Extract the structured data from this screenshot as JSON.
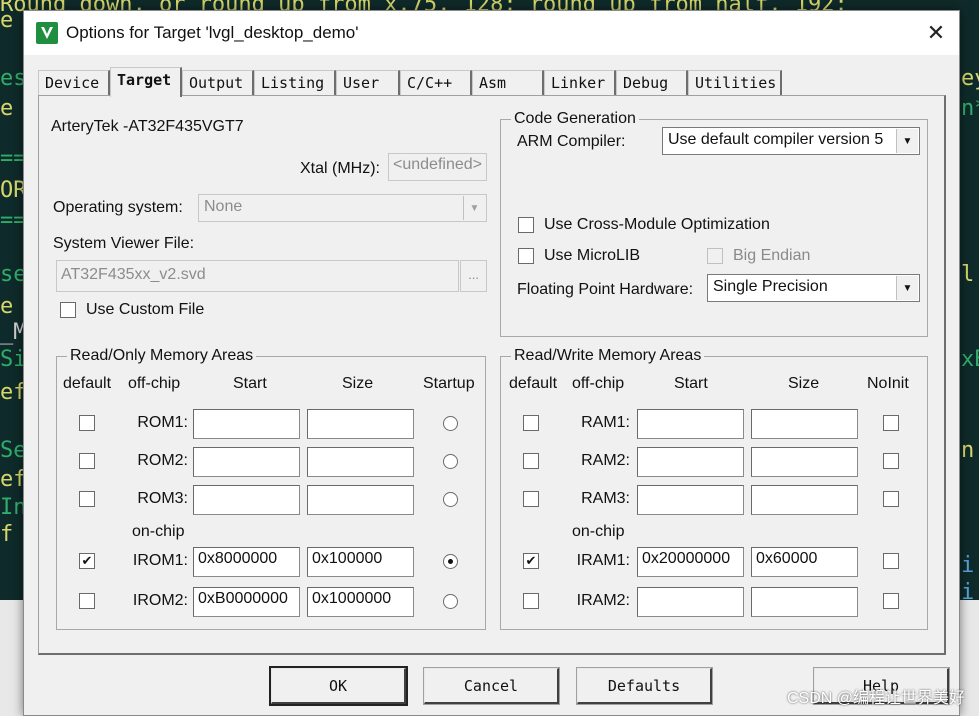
{
  "window": {
    "title": "Options for Target 'lvgl_desktop_demo'",
    "app_icon": "keil-uvision-icon",
    "close_label": "✕"
  },
  "tabs": [
    "Device",
    "Target",
    "Output",
    "Listing",
    "User",
    "C/C++",
    "Asm",
    "Linker",
    "Debug",
    "Utilities"
  ],
  "active_tab": "Target",
  "target": {
    "device_name": "ArteryTek -AT32F435VGT7",
    "xtal_label": "Xtal (MHz):",
    "xtal_value": "<undefined>",
    "os_label": "Operating system:",
    "os_value": "None",
    "svd_label": "System Viewer File:",
    "svd_value": "AT32F435xx_v2.svd",
    "browse_label": "...",
    "custom_file_label": "Use Custom File",
    "custom_file_checked": false
  },
  "code_generation": {
    "title": "Code Generation",
    "compiler_label": "ARM Compiler:",
    "compiler_value": "Use default compiler version 5",
    "cross_module_label": "Use Cross-Module Optimization",
    "cross_module_checked": false,
    "microlib_label": "Use MicroLIB",
    "microlib_checked": false,
    "big_endian_label": "Big Endian",
    "big_endian_checked": false,
    "fpu_label": "Floating Point Hardware:",
    "fpu_value": "Single Precision"
  },
  "ro_memory": {
    "title": "Read/Only Memory Areas",
    "col_default": "default",
    "col_offchip": "off-chip",
    "col_start": "Start",
    "col_size": "Size",
    "col_startup": "Startup",
    "onchip_label": "on-chip",
    "rows": [
      {
        "name": "ROM1:",
        "start": "",
        "size": "",
        "default": false,
        "startup": false
      },
      {
        "name": "ROM2:",
        "start": "",
        "size": "",
        "default": false,
        "startup": false
      },
      {
        "name": "ROM3:",
        "start": "",
        "size": "",
        "default": false,
        "startup": false
      },
      {
        "name": "IROM1:",
        "start": "0x8000000",
        "size": "0x100000",
        "default": true,
        "startup": true
      },
      {
        "name": "IROM2:",
        "start": "0xB0000000",
        "size": "0x1000000",
        "default": false,
        "startup": false
      }
    ]
  },
  "rw_memory": {
    "title": "Read/Write Memory Areas",
    "col_default": "default",
    "col_offchip": "off-chip",
    "col_start": "Start",
    "col_size": "Size",
    "col_noinit": "NoInit",
    "onchip_label": "on-chip",
    "rows": [
      {
        "name": "RAM1:",
        "start": "",
        "size": "",
        "default": false,
        "noinit": false
      },
      {
        "name": "RAM2:",
        "start": "",
        "size": "",
        "default": false,
        "noinit": false
      },
      {
        "name": "RAM3:",
        "start": "",
        "size": "",
        "default": false,
        "noinit": false
      },
      {
        "name": "IRAM1:",
        "start": "0x20000000",
        "size": "0x60000",
        "default": true,
        "noinit": false
      },
      {
        "name": "IRAM2:",
        "start": "",
        "size": "",
        "default": false,
        "noinit": false
      }
    ]
  },
  "buttons": {
    "ok": "OK",
    "cancel": "Cancel",
    "defaults": "Defaults",
    "help": "Help"
  },
  "background": {
    "top_code": "Round down, or round up from x.75, 128: round up from half, 192:",
    "left_chars": [
      "e",
      "es",
      "e",
      "==",
      "OR",
      "==",
      "se",
      "e",
      "_M",
      "Si",
      "ef",
      "Se",
      "ef",
      "In",
      "f"
    ],
    "right_chars": [
      "ey",
      "n*",
      "l",
      "xB",
      "n",
      "i",
      "i"
    ]
  },
  "watermark": "CSDN @编程让世界美好",
  "colors": {
    "dialog_bg": "#f0f0f0",
    "ide_bg": "#0f2a2a",
    "ide_code_yellow": "#d7d76b",
    "ide_code_green": "#2fae6a"
  }
}
